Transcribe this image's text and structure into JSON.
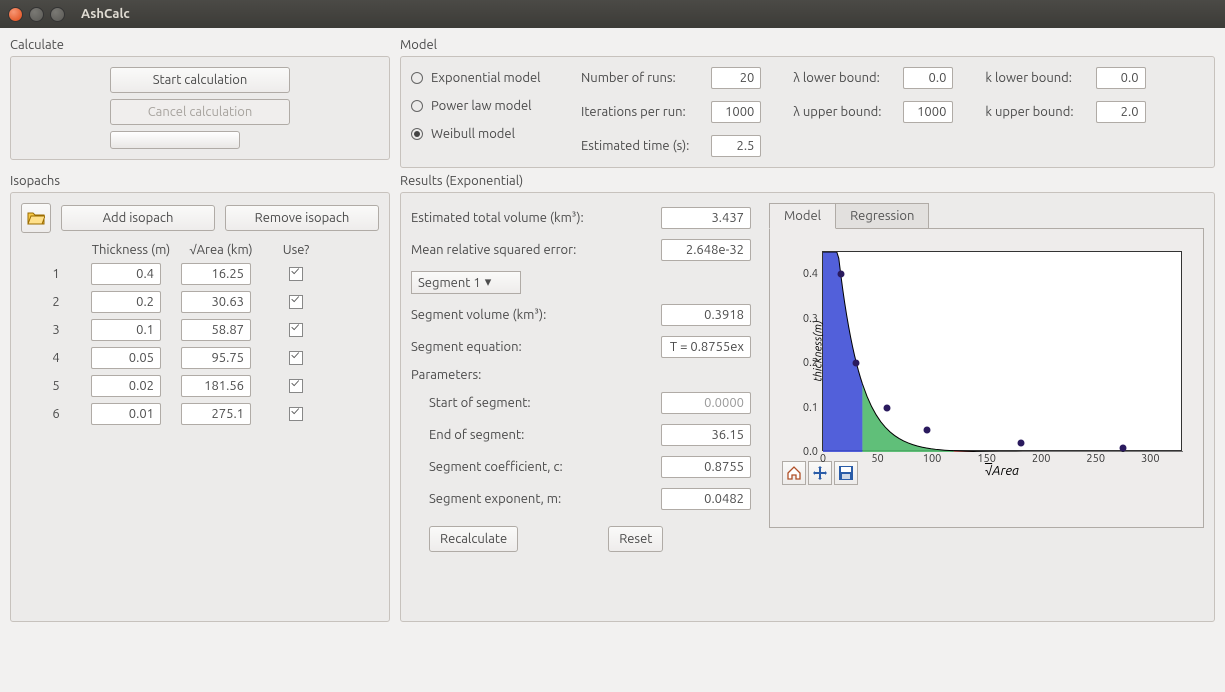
{
  "window": {
    "title": "AshCalc"
  },
  "calculate": {
    "label": "Calculate",
    "start": "Start calculation",
    "cancel": "Cancel calculation"
  },
  "model": {
    "label": "Model",
    "options": {
      "exp": "Exponential model",
      "pow": "Power law model",
      "wei": "Weibull model"
    },
    "selected": "wei",
    "params": {
      "runs_label": "Number of runs:",
      "runs": "20",
      "iter_label": "Iterations per run:",
      "iter": "1000",
      "time_label": "Estimated time (s):",
      "time": "2.5",
      "llb_label": "λ lower bound:",
      "llb": "0.0",
      "lub_label": "λ upper bound:",
      "lub": "1000",
      "klb_label": "k lower bound:",
      "klb": "0.0",
      "kub_label": "k upper bound:",
      "kub": "2.0"
    }
  },
  "isopachs": {
    "label": "Isopachs",
    "add": "Add isopach",
    "remove": "Remove isopach",
    "headers": {
      "thickness": "Thickness (m)",
      "area": "√Area (km)",
      "use": "Use?"
    },
    "rows": [
      {
        "idx": "1",
        "thickness": "0.4",
        "area": "16.25",
        "use": true
      },
      {
        "idx": "2",
        "thickness": "0.2",
        "area": "30.63",
        "use": true
      },
      {
        "idx": "3",
        "thickness": "0.1",
        "area": "58.87",
        "use": true
      },
      {
        "idx": "4",
        "thickness": "0.05",
        "area": "95.75",
        "use": true
      },
      {
        "idx": "5",
        "thickness": "0.02",
        "area": "181.56",
        "use": true
      },
      {
        "idx": "6",
        "thickness": "0.01",
        "area": "275.1",
        "use": true
      }
    ]
  },
  "results": {
    "label": "Results (Exponential)",
    "total_vol_label": "Estimated total volume (km³):",
    "total_vol": "3.437",
    "mrse_label": "Mean relative squared error:",
    "mrse": "2.648e-32",
    "segment_sel": "Segment 1",
    "seg_vol_label": "Segment volume (km³):",
    "seg_vol": "0.3918",
    "seg_eq_label": "Segment equation:",
    "seg_eq": "T = 0.8755ex",
    "params_label": "Parameters:",
    "start_label": "Start of segment:",
    "start": "0.0000",
    "end_label": "End of segment:",
    "end": "36.15",
    "coef_label": "Segment coefficient, c:",
    "coef": "0.8755",
    "exp_label": "Segment exponent, m:",
    "exp": "0.0482",
    "recalc": "Recalculate",
    "reset": "Reset",
    "tabs": {
      "model": "Model",
      "regression": "Regression"
    }
  },
  "chart_data": {
    "type": "scatter",
    "xlabel": "√Area",
    "ylabel": "thickness(m)",
    "xlim": [
      0,
      330
    ],
    "ylim": [
      0,
      0.45
    ],
    "xticks": [
      0,
      50,
      100,
      150,
      200,
      250,
      300
    ],
    "yticks": [
      0.0,
      0.1,
      0.2,
      0.3,
      0.4
    ],
    "points": [
      {
        "x": 16.25,
        "y": 0.4
      },
      {
        "x": 30.63,
        "y": 0.2
      },
      {
        "x": 58.87,
        "y": 0.1
      },
      {
        "x": 95.75,
        "y": 0.05
      },
      {
        "x": 181.56,
        "y": 0.02
      },
      {
        "x": 275.1,
        "y": 0.01
      }
    ],
    "segments": [
      {
        "color": "#3f4fd6",
        "x0": 0,
        "x1": 36.15
      },
      {
        "color": "#4fb86a",
        "x0": 36.15,
        "x1": 120
      },
      {
        "color": "#ef6a63",
        "x0": 120,
        "x1": 330
      }
    ]
  }
}
